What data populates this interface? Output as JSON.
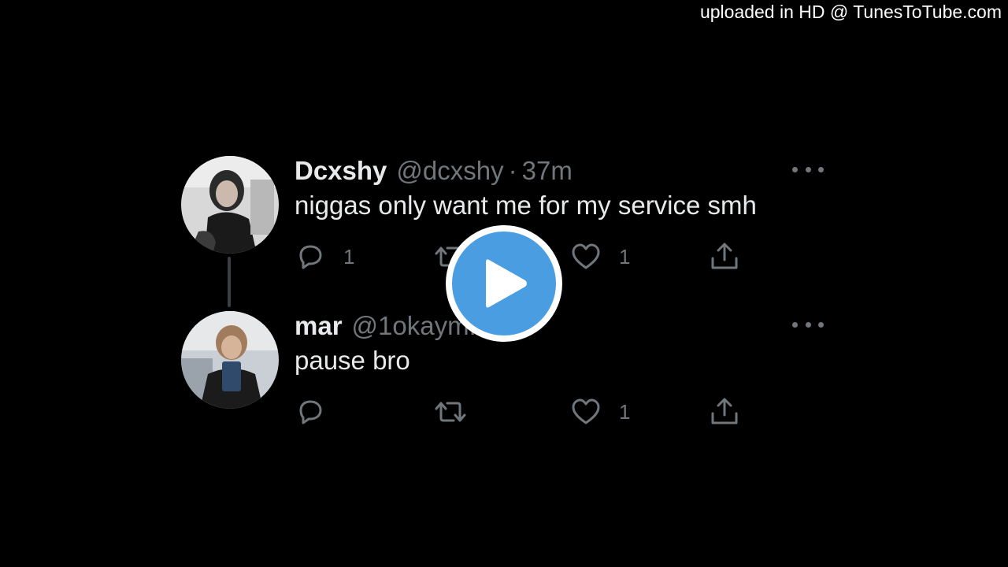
{
  "watermark": "uploaded in HD @ TunesToTube.com",
  "tweets": [
    {
      "display_name": "Dcxshy",
      "handle": "@dcxshy",
      "separator": "·",
      "time": "37m",
      "text": "niggas only want me for my service smh",
      "reply_count": "1",
      "retweet_count": "",
      "like_count": "1"
    },
    {
      "display_name": "mar",
      "handle": "@1okaym...om",
      "text": "pause bro",
      "reply_count": "",
      "retweet_count": "",
      "like_count": "1"
    }
  ],
  "icons": {
    "reply": "reply-icon",
    "retweet": "retweet-icon",
    "like": "heart-icon",
    "share": "share-icon",
    "more": "more-icon",
    "play": "play-icon"
  },
  "colors": {
    "background": "#000000",
    "text": "#e7e9ea",
    "muted": "#71767b",
    "play_button": "#4a9de0"
  }
}
